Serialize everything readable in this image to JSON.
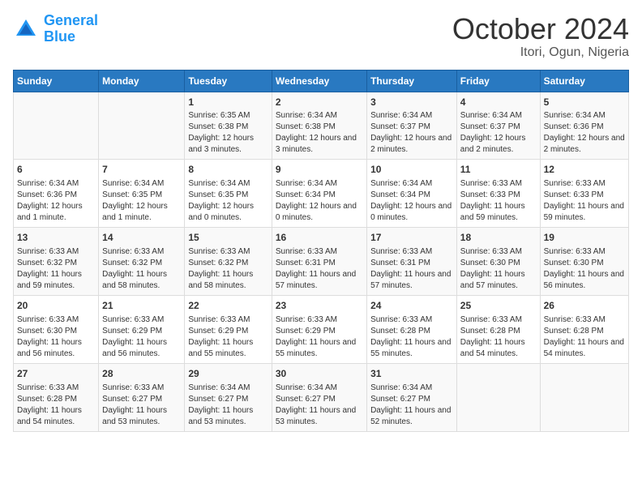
{
  "header": {
    "logo_general": "General",
    "logo_blue": "Blue",
    "title": "October 2024",
    "subtitle": "Itori, Ogun, Nigeria"
  },
  "weekdays": [
    "Sunday",
    "Monday",
    "Tuesday",
    "Wednesday",
    "Thursday",
    "Friday",
    "Saturday"
  ],
  "weeks": [
    [
      {
        "day": "",
        "info": ""
      },
      {
        "day": "",
        "info": ""
      },
      {
        "day": "1",
        "info": "Sunrise: 6:35 AM\nSunset: 6:38 PM\nDaylight: 12 hours and 3 minutes."
      },
      {
        "day": "2",
        "info": "Sunrise: 6:34 AM\nSunset: 6:38 PM\nDaylight: 12 hours and 3 minutes."
      },
      {
        "day": "3",
        "info": "Sunrise: 6:34 AM\nSunset: 6:37 PM\nDaylight: 12 hours and 2 minutes."
      },
      {
        "day": "4",
        "info": "Sunrise: 6:34 AM\nSunset: 6:37 PM\nDaylight: 12 hours and 2 minutes."
      },
      {
        "day": "5",
        "info": "Sunrise: 6:34 AM\nSunset: 6:36 PM\nDaylight: 12 hours and 2 minutes."
      }
    ],
    [
      {
        "day": "6",
        "info": "Sunrise: 6:34 AM\nSunset: 6:36 PM\nDaylight: 12 hours and 1 minute."
      },
      {
        "day": "7",
        "info": "Sunrise: 6:34 AM\nSunset: 6:35 PM\nDaylight: 12 hours and 1 minute."
      },
      {
        "day": "8",
        "info": "Sunrise: 6:34 AM\nSunset: 6:35 PM\nDaylight: 12 hours and 0 minutes."
      },
      {
        "day": "9",
        "info": "Sunrise: 6:34 AM\nSunset: 6:34 PM\nDaylight: 12 hours and 0 minutes."
      },
      {
        "day": "10",
        "info": "Sunrise: 6:34 AM\nSunset: 6:34 PM\nDaylight: 12 hours and 0 minutes."
      },
      {
        "day": "11",
        "info": "Sunrise: 6:33 AM\nSunset: 6:33 PM\nDaylight: 11 hours and 59 minutes."
      },
      {
        "day": "12",
        "info": "Sunrise: 6:33 AM\nSunset: 6:33 PM\nDaylight: 11 hours and 59 minutes."
      }
    ],
    [
      {
        "day": "13",
        "info": "Sunrise: 6:33 AM\nSunset: 6:32 PM\nDaylight: 11 hours and 59 minutes."
      },
      {
        "day": "14",
        "info": "Sunrise: 6:33 AM\nSunset: 6:32 PM\nDaylight: 11 hours and 58 minutes."
      },
      {
        "day": "15",
        "info": "Sunrise: 6:33 AM\nSunset: 6:32 PM\nDaylight: 11 hours and 58 minutes."
      },
      {
        "day": "16",
        "info": "Sunrise: 6:33 AM\nSunset: 6:31 PM\nDaylight: 11 hours and 57 minutes."
      },
      {
        "day": "17",
        "info": "Sunrise: 6:33 AM\nSunset: 6:31 PM\nDaylight: 11 hours and 57 minutes."
      },
      {
        "day": "18",
        "info": "Sunrise: 6:33 AM\nSunset: 6:30 PM\nDaylight: 11 hours and 57 minutes."
      },
      {
        "day": "19",
        "info": "Sunrise: 6:33 AM\nSunset: 6:30 PM\nDaylight: 11 hours and 56 minutes."
      }
    ],
    [
      {
        "day": "20",
        "info": "Sunrise: 6:33 AM\nSunset: 6:30 PM\nDaylight: 11 hours and 56 minutes."
      },
      {
        "day": "21",
        "info": "Sunrise: 6:33 AM\nSunset: 6:29 PM\nDaylight: 11 hours and 56 minutes."
      },
      {
        "day": "22",
        "info": "Sunrise: 6:33 AM\nSunset: 6:29 PM\nDaylight: 11 hours and 55 minutes."
      },
      {
        "day": "23",
        "info": "Sunrise: 6:33 AM\nSunset: 6:29 PM\nDaylight: 11 hours and 55 minutes."
      },
      {
        "day": "24",
        "info": "Sunrise: 6:33 AM\nSunset: 6:28 PM\nDaylight: 11 hours and 55 minutes."
      },
      {
        "day": "25",
        "info": "Sunrise: 6:33 AM\nSunset: 6:28 PM\nDaylight: 11 hours and 54 minutes."
      },
      {
        "day": "26",
        "info": "Sunrise: 6:33 AM\nSunset: 6:28 PM\nDaylight: 11 hours and 54 minutes."
      }
    ],
    [
      {
        "day": "27",
        "info": "Sunrise: 6:33 AM\nSunset: 6:28 PM\nDaylight: 11 hours and 54 minutes."
      },
      {
        "day": "28",
        "info": "Sunrise: 6:33 AM\nSunset: 6:27 PM\nDaylight: 11 hours and 53 minutes."
      },
      {
        "day": "29",
        "info": "Sunrise: 6:34 AM\nSunset: 6:27 PM\nDaylight: 11 hours and 53 minutes."
      },
      {
        "day": "30",
        "info": "Sunrise: 6:34 AM\nSunset: 6:27 PM\nDaylight: 11 hours and 53 minutes."
      },
      {
        "day": "31",
        "info": "Sunrise: 6:34 AM\nSunset: 6:27 PM\nDaylight: 11 hours and 52 minutes."
      },
      {
        "day": "",
        "info": ""
      },
      {
        "day": "",
        "info": ""
      }
    ]
  ]
}
